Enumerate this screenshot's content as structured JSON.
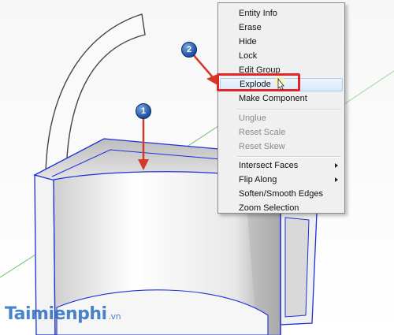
{
  "context_menu": {
    "items": [
      {
        "label": "Entity Info",
        "enabled": true
      },
      {
        "label": "Erase",
        "enabled": true
      },
      {
        "label": "Hide",
        "enabled": true
      },
      {
        "label": "Lock",
        "enabled": true
      },
      {
        "label": "Edit Group",
        "enabled": true
      },
      {
        "label": "Explode",
        "enabled": true,
        "highlighted": true
      },
      {
        "label": "Make Component",
        "enabled": true
      },
      {
        "label": "Unglue",
        "enabled": false
      },
      {
        "label": "Reset Scale",
        "enabled": false
      },
      {
        "label": "Reset Skew",
        "enabled": false
      },
      {
        "label": "Intersect Faces",
        "enabled": true,
        "submenu": true
      },
      {
        "label": "Flip Along",
        "enabled": true,
        "submenu": true
      },
      {
        "label": "Soften/Smooth Edges",
        "enabled": true
      },
      {
        "label": "Zoom Selection",
        "enabled": true
      }
    ]
  },
  "steps": {
    "step1": "1",
    "step2": "2"
  },
  "watermark": {
    "name": "Taimienphi",
    "tld": ".vn"
  },
  "colors": {
    "selection_edges": "#1c2fd8",
    "highlight_box": "#e22526",
    "axis_green": "#3fae3f",
    "menu_highlight": "#d7e8fb"
  }
}
